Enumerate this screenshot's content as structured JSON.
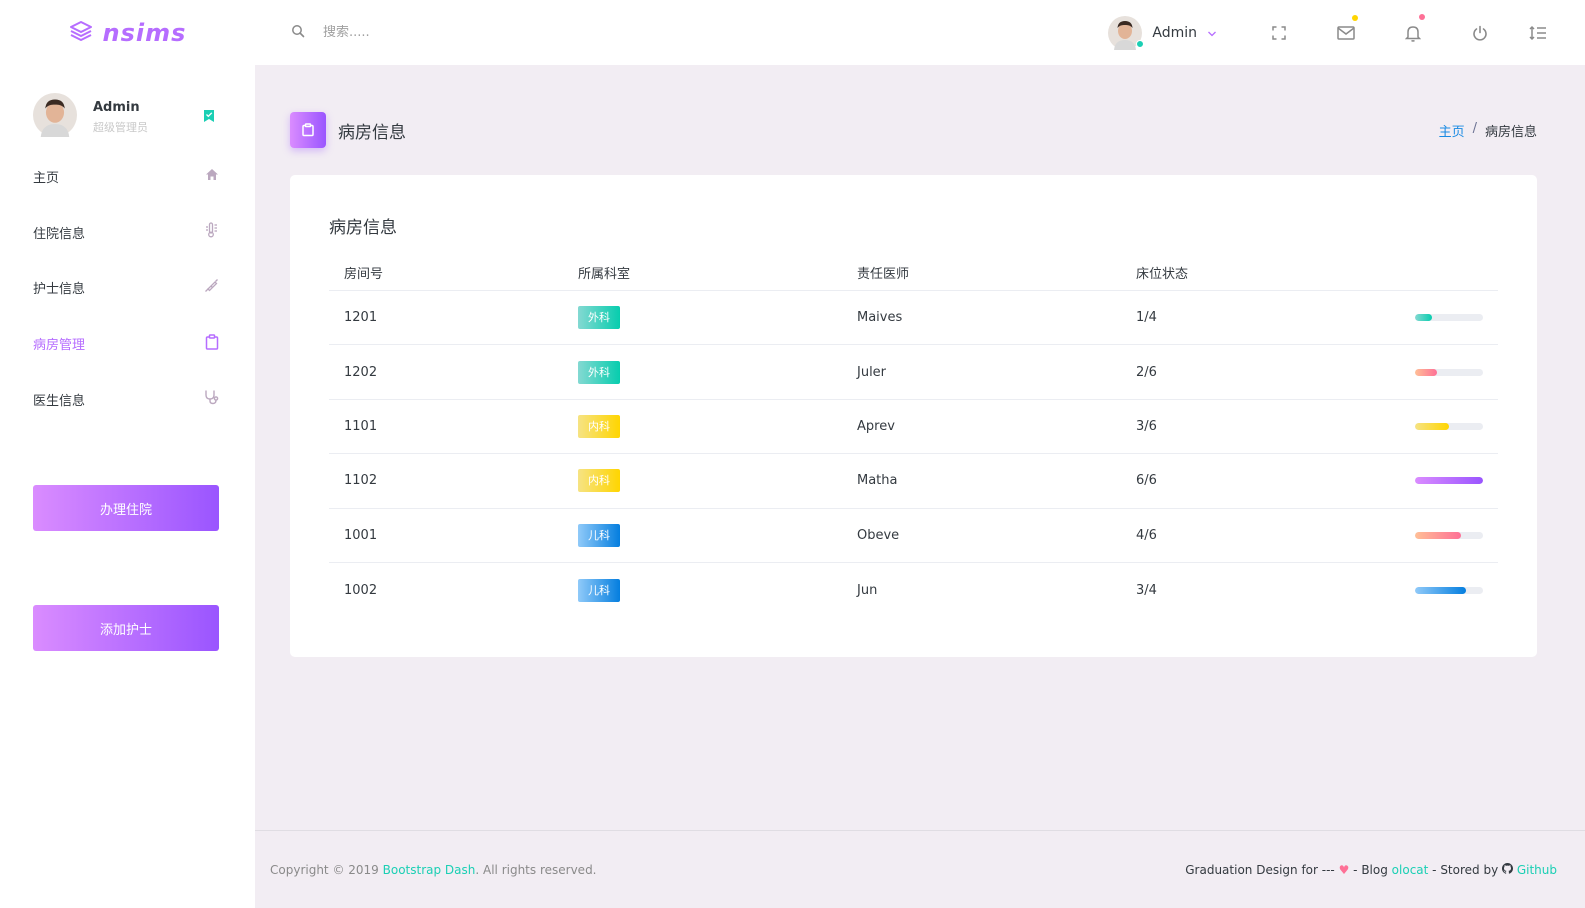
{
  "brand": {
    "logo_text": "nsims"
  },
  "search": {
    "placeholder": "搜索....."
  },
  "top_profile": {
    "name": "Admin"
  },
  "sidebar": {
    "profile": {
      "name": "Admin",
      "role": "超级管理员"
    },
    "items": [
      {
        "label": "主页",
        "icon": "home-icon"
      },
      {
        "label": "住院信息",
        "icon": "thermometer-icon"
      },
      {
        "label": "护士信息",
        "icon": "syringe-icon"
      },
      {
        "label": "病房管理",
        "icon": "clipboard-icon",
        "active": true
      },
      {
        "label": "医生信息",
        "icon": "stethoscope-icon"
      }
    ],
    "buttons": {
      "admit": "办理住院",
      "add_nurse": "添加护士"
    }
  },
  "page": {
    "title": "病房信息",
    "breadcrumb": {
      "home": "主页",
      "separator": "/",
      "current": "病房信息"
    }
  },
  "card": {
    "title": "病房信息",
    "columns": [
      "房间号",
      "所属科室",
      "责任医师",
      "床位状态"
    ],
    "rows": [
      {
        "room": "1201",
        "dept": "外科",
        "dept_style": "success",
        "doctor": "Maives",
        "beds": "1/4",
        "fill": 0.25,
        "bar": "success"
      },
      {
        "room": "1202",
        "dept": "外科",
        "dept_style": "success",
        "doctor": "Juler",
        "beds": "2/6",
        "fill": 0.33,
        "bar": "danger"
      },
      {
        "room": "1101",
        "dept": "内科",
        "dept_style": "warning",
        "doctor": "Aprev",
        "beds": "3/6",
        "fill": 0.5,
        "bar": "warning"
      },
      {
        "room": "1102",
        "dept": "内科",
        "dept_style": "warning",
        "doctor": "Matha",
        "beds": "6/6",
        "fill": 1.0,
        "bar": "primary"
      },
      {
        "room": "1001",
        "dept": "儿科",
        "dept_style": "info",
        "doctor": "Obeve",
        "beds": "4/6",
        "fill": 0.67,
        "bar": "danger"
      },
      {
        "room": "1002",
        "dept": "儿科",
        "dept_style": "info",
        "doctor": "Jun",
        "beds": "3/4",
        "fill": 0.75,
        "bar": "info"
      }
    ]
  },
  "footer": {
    "copyright_prefix": "Copyright © 2019 ",
    "copyright_link": "Bootstrap Dash",
    "copyright_suffix": ". All rights reserved.",
    "design_text": "Graduation Design for ---",
    "blog_text": " - Blog ",
    "blog_link": "olocat",
    "stored_text": " - Stored by ",
    "github_link": "Github"
  },
  "colors": {
    "primary": "#b66dff",
    "success": "#1bcfb4",
    "link": "#198ae3",
    "heart": "#fe7096",
    "mail_dot": "#ffd500",
    "bell_dot": "#fe7096"
  }
}
